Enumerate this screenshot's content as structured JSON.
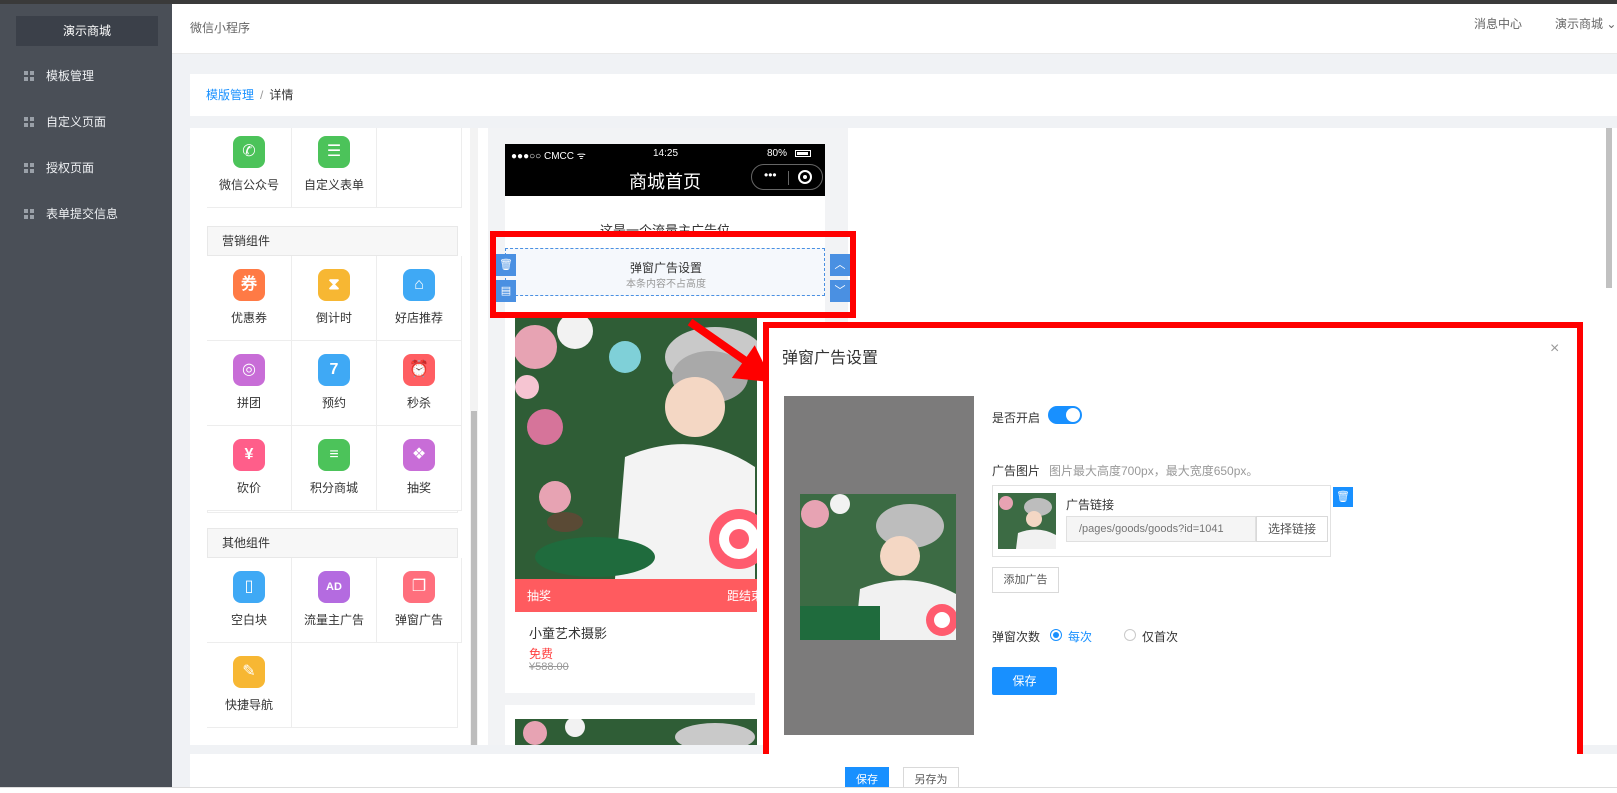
{
  "sidebar": {
    "brand": "演示商城",
    "items": [
      {
        "label": "模板管理"
      },
      {
        "label": "自定义页面"
      },
      {
        "label": "授权页面"
      },
      {
        "label": "表单提交信息"
      }
    ]
  },
  "header": {
    "title": "微信小程序",
    "messages": "消息中心",
    "user": "演示商城"
  },
  "breadcrumb": {
    "root": "模版管理",
    "separator": "/",
    "current": "详情"
  },
  "components": {
    "top": [
      {
        "label": "微信公众号",
        "icon": "wechat-icon",
        "color": "#4cc35a",
        "glyph": "✆"
      },
      {
        "label": "自定义表单",
        "icon": "form-icon",
        "color": "#4cc35a",
        "glyph": "☰"
      }
    ],
    "marketing_title": "营销组件",
    "marketing": [
      {
        "label": "优惠券",
        "icon": "coupon-icon",
        "color": "#ff7a45",
        "glyph": "券"
      },
      {
        "label": "倒计时",
        "icon": "hourglass-icon",
        "color": "#f7b733",
        "glyph": "⧗"
      },
      {
        "label": "好店推荐",
        "icon": "shop-icon",
        "color": "#3fa9f5",
        "glyph": "⌂"
      },
      {
        "label": "拼团",
        "icon": "group-icon",
        "color": "#c86dd7",
        "glyph": "◎"
      },
      {
        "label": "预约",
        "icon": "calendar-icon",
        "color": "#3fa9f5",
        "glyph": "7"
      },
      {
        "label": "秒杀",
        "icon": "alarm-icon",
        "color": "#ff5e62",
        "glyph": "⏰"
      },
      {
        "label": "砍价",
        "icon": "yen-icon",
        "color": "#ff5e8a",
        "glyph": "¥"
      },
      {
        "label": "积分商城",
        "icon": "coins-icon",
        "color": "#4cc35a",
        "glyph": "≡"
      },
      {
        "label": "抽奖",
        "icon": "gift-icon",
        "color": "#c86dd7",
        "glyph": "❖"
      }
    ],
    "other_title": "其他组件",
    "other": [
      {
        "label": "空白块",
        "icon": "blank-page-icon",
        "color": "#3fa9f5",
        "glyph": "▯"
      },
      {
        "label": "流量主广告",
        "icon": "ad-icon",
        "color": "#b46be0",
        "glyph": "AD"
      },
      {
        "label": "弹窗广告",
        "icon": "popup-icon",
        "color": "#ff6f7d",
        "glyph": "❐"
      },
      {
        "label": "快捷导航",
        "icon": "compass-icon",
        "color": "#f7b733",
        "glyph": "✎"
      }
    ]
  },
  "phone": {
    "carrier": "●●●○○ CMCC ᯤ",
    "time": "14:25",
    "battery": "80%",
    "title": "商城首页",
    "capsule_dots": "•••",
    "ad_text": "这是一个流量主广告位",
    "popup_title": "弹窗广告设置",
    "popup_sub": "本条内容不占高度",
    "delete_glyph": "🗑",
    "copy_glyph": "▤",
    "up_glyph": "︿",
    "down_glyph": "﹀",
    "lottery_label": "抽奖",
    "countdown_label": "距结束",
    "product_name": "小童艺术摄影",
    "product_price": "免费",
    "product_old_price": "¥588.00"
  },
  "dialog": {
    "title": "弹窗广告设置",
    "close": "×",
    "enable_label": "是否开启",
    "enabled": true,
    "image_label": "广告图片",
    "image_hint": "图片最大高度700px，最大宽度650px。",
    "link_label": "广告链接",
    "link_placeholder": "/pages/goods/goods?id=1041",
    "choose_link": "选择链接",
    "delete_glyph": "🗑",
    "add_ad": "添加广告",
    "times_label": "弹窗次数",
    "option_every": "每次",
    "option_first": "仅首次",
    "selected": "每次",
    "save": "保存"
  },
  "footer": {
    "save": "保存",
    "save_as": "另存为"
  },
  "colors": {
    "accent": "#1890ff",
    "sidebar": "#4a4f57",
    "highlight": "#ff0000"
  }
}
